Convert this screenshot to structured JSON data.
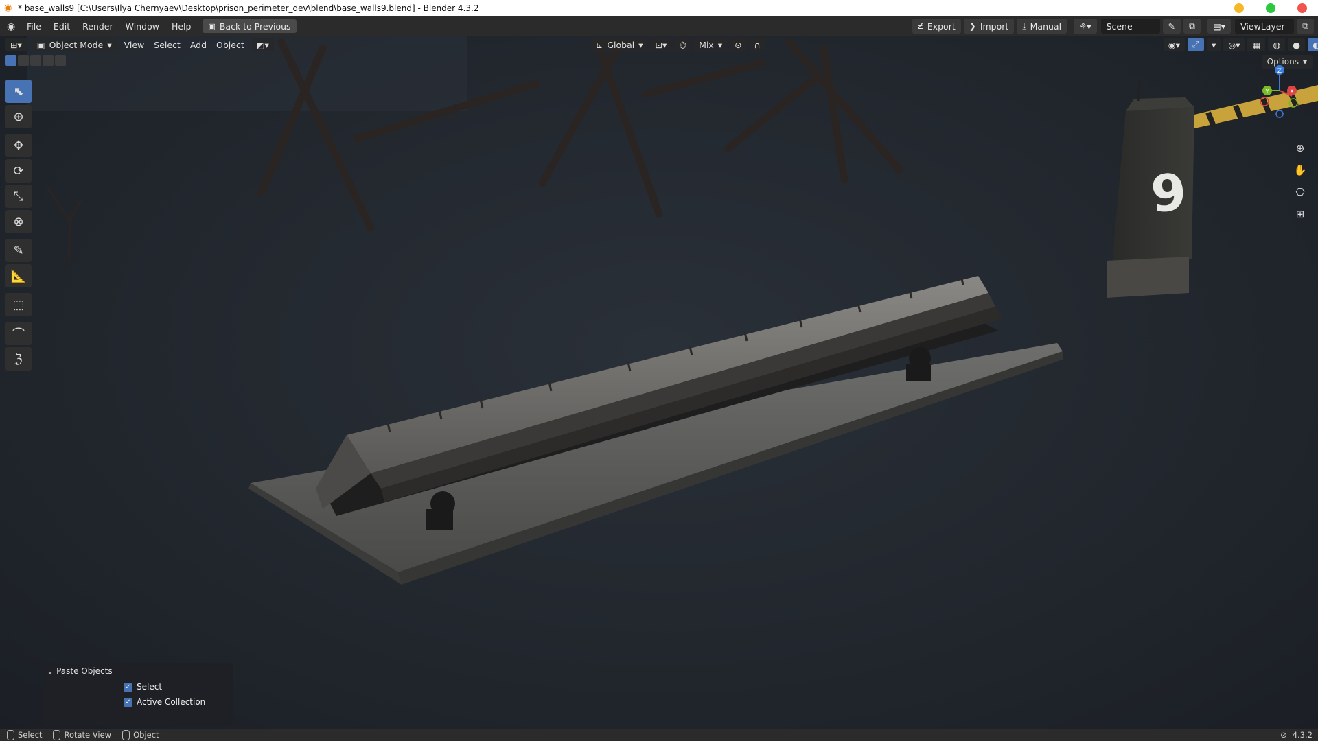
{
  "window": {
    "title": "* base_walls9 [C:\\Users\\Ilya Chernyaev\\Desktop\\prison_perimeter_dev\\blend\\base_walls9.blend] - Blender 4.3.2",
    "controls": {
      "minimize_color": "#f5b829",
      "maximize_color": "#2bc840",
      "close_color": "#f0544c"
    }
  },
  "topbar": {
    "menu": [
      "File",
      "Edit",
      "Render",
      "Window",
      "Help"
    ],
    "back_label": "Back to Previous",
    "export_label": "Export",
    "import_label": "Import",
    "manual_label": "Manual",
    "scene_label": "Scene",
    "viewlayer_label": "ViewLayer"
  },
  "viewport_header": {
    "mode_label": "Object Mode",
    "menu": [
      "View",
      "Select",
      "Add",
      "Object"
    ],
    "orientation_label": "Global",
    "snap_label": "Mix",
    "options_label": "Options"
  },
  "gizmo": {
    "z": "Z",
    "y": "Y",
    "x": "X"
  },
  "scene": {
    "post_number": "9"
  },
  "paste_panel": {
    "title": "Paste Objects",
    "select_label": "Select",
    "select_checked": true,
    "active_collection_label": "Active Collection",
    "active_collection_checked": true
  },
  "statusbar": {
    "select_label": "Select",
    "rotate_label": "Rotate View",
    "object_label": "Object",
    "version": "4.3.2"
  },
  "colors": {
    "accent": "#4772b3",
    "header": "#2b2b2b"
  }
}
